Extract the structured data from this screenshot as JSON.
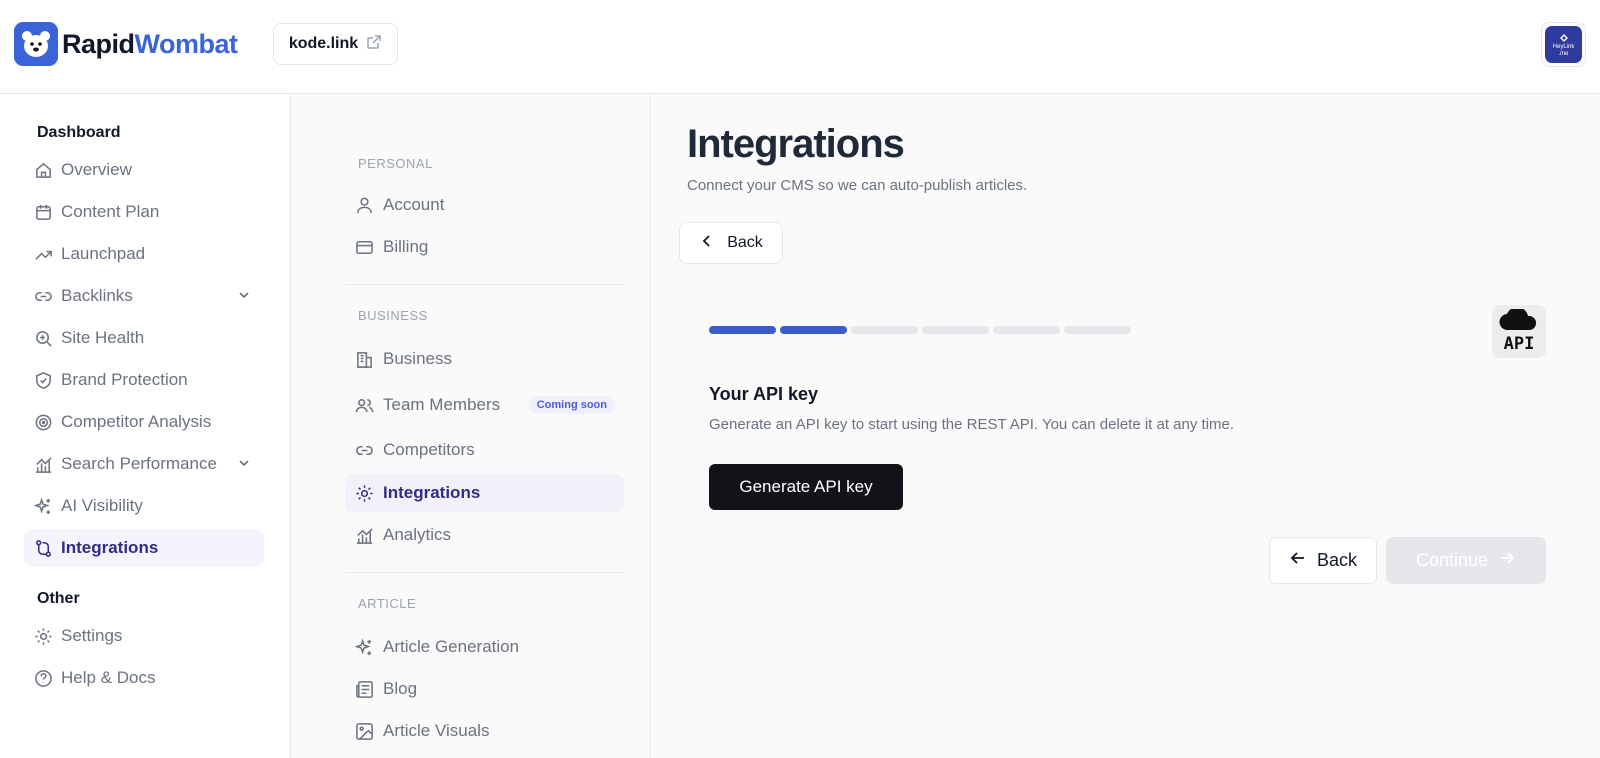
{
  "brand": {
    "name_part1": "Rapid",
    "name_part2": "Wombat",
    "accent": "#3b64d8"
  },
  "header": {
    "site_label": "kode.link",
    "avatar_line1": "HeyLink",
    "avatar_line2": ".me"
  },
  "sidebar": {
    "section_dashboard": "Dashboard",
    "items": [
      {
        "label": "Overview",
        "icon": "home-icon"
      },
      {
        "label": "Content Plan",
        "icon": "calendar-icon"
      },
      {
        "label": "Launchpad",
        "icon": "trending-up-icon"
      },
      {
        "label": "Backlinks",
        "icon": "link-icon"
      },
      {
        "label": "Site Health",
        "icon": "search-health-icon"
      },
      {
        "label": "Brand Protection",
        "icon": "shield-icon"
      },
      {
        "label": "Competitor Analysis",
        "icon": "radar-icon"
      },
      {
        "label": "Search Performance",
        "icon": "chart-icon"
      },
      {
        "label": "AI Visibility",
        "icon": "sparkles-icon"
      },
      {
        "label": "Integrations",
        "icon": "git-branch-icon"
      }
    ],
    "section_other": "Other",
    "other_items": [
      {
        "label": "Settings",
        "icon": "gear-icon"
      },
      {
        "label": "Help & Docs",
        "icon": "help-icon"
      }
    ]
  },
  "settings_nav": {
    "section_personal": "PERSONAL",
    "personal": [
      {
        "label": "Account",
        "icon": "user-icon"
      },
      {
        "label": "Billing",
        "icon": "credit-card-icon"
      }
    ],
    "section_business": "BUSINESS",
    "business": [
      {
        "label": "Business",
        "icon": "building-icon"
      },
      {
        "label": "Team Members",
        "icon": "users-icon",
        "badge": "Coming soon"
      },
      {
        "label": "Competitors",
        "icon": "link-icon"
      },
      {
        "label": "Integrations",
        "icon": "gear-icon"
      },
      {
        "label": "Analytics",
        "icon": "chart-icon"
      }
    ],
    "section_article": "ARTICLE",
    "article": [
      {
        "label": "Article Generation",
        "icon": "sparkles-icon"
      },
      {
        "label": "Blog",
        "icon": "newspaper-icon"
      },
      {
        "label": "Article Visuals",
        "icon": "image-icon"
      }
    ]
  },
  "main": {
    "title": "Integrations",
    "subtitle": "Connect your CMS so we can auto-publish articles.",
    "back_label": "Back",
    "progress": {
      "completed_steps": 2,
      "total_steps": 6
    },
    "api_logo_text": "API",
    "key_title": "Your API key",
    "key_description": "Generate an API key to start using the REST API. You can delete it at any time.",
    "generate_label": "Generate API key",
    "footer_back_label": "Back",
    "continue_label": "Continue"
  }
}
